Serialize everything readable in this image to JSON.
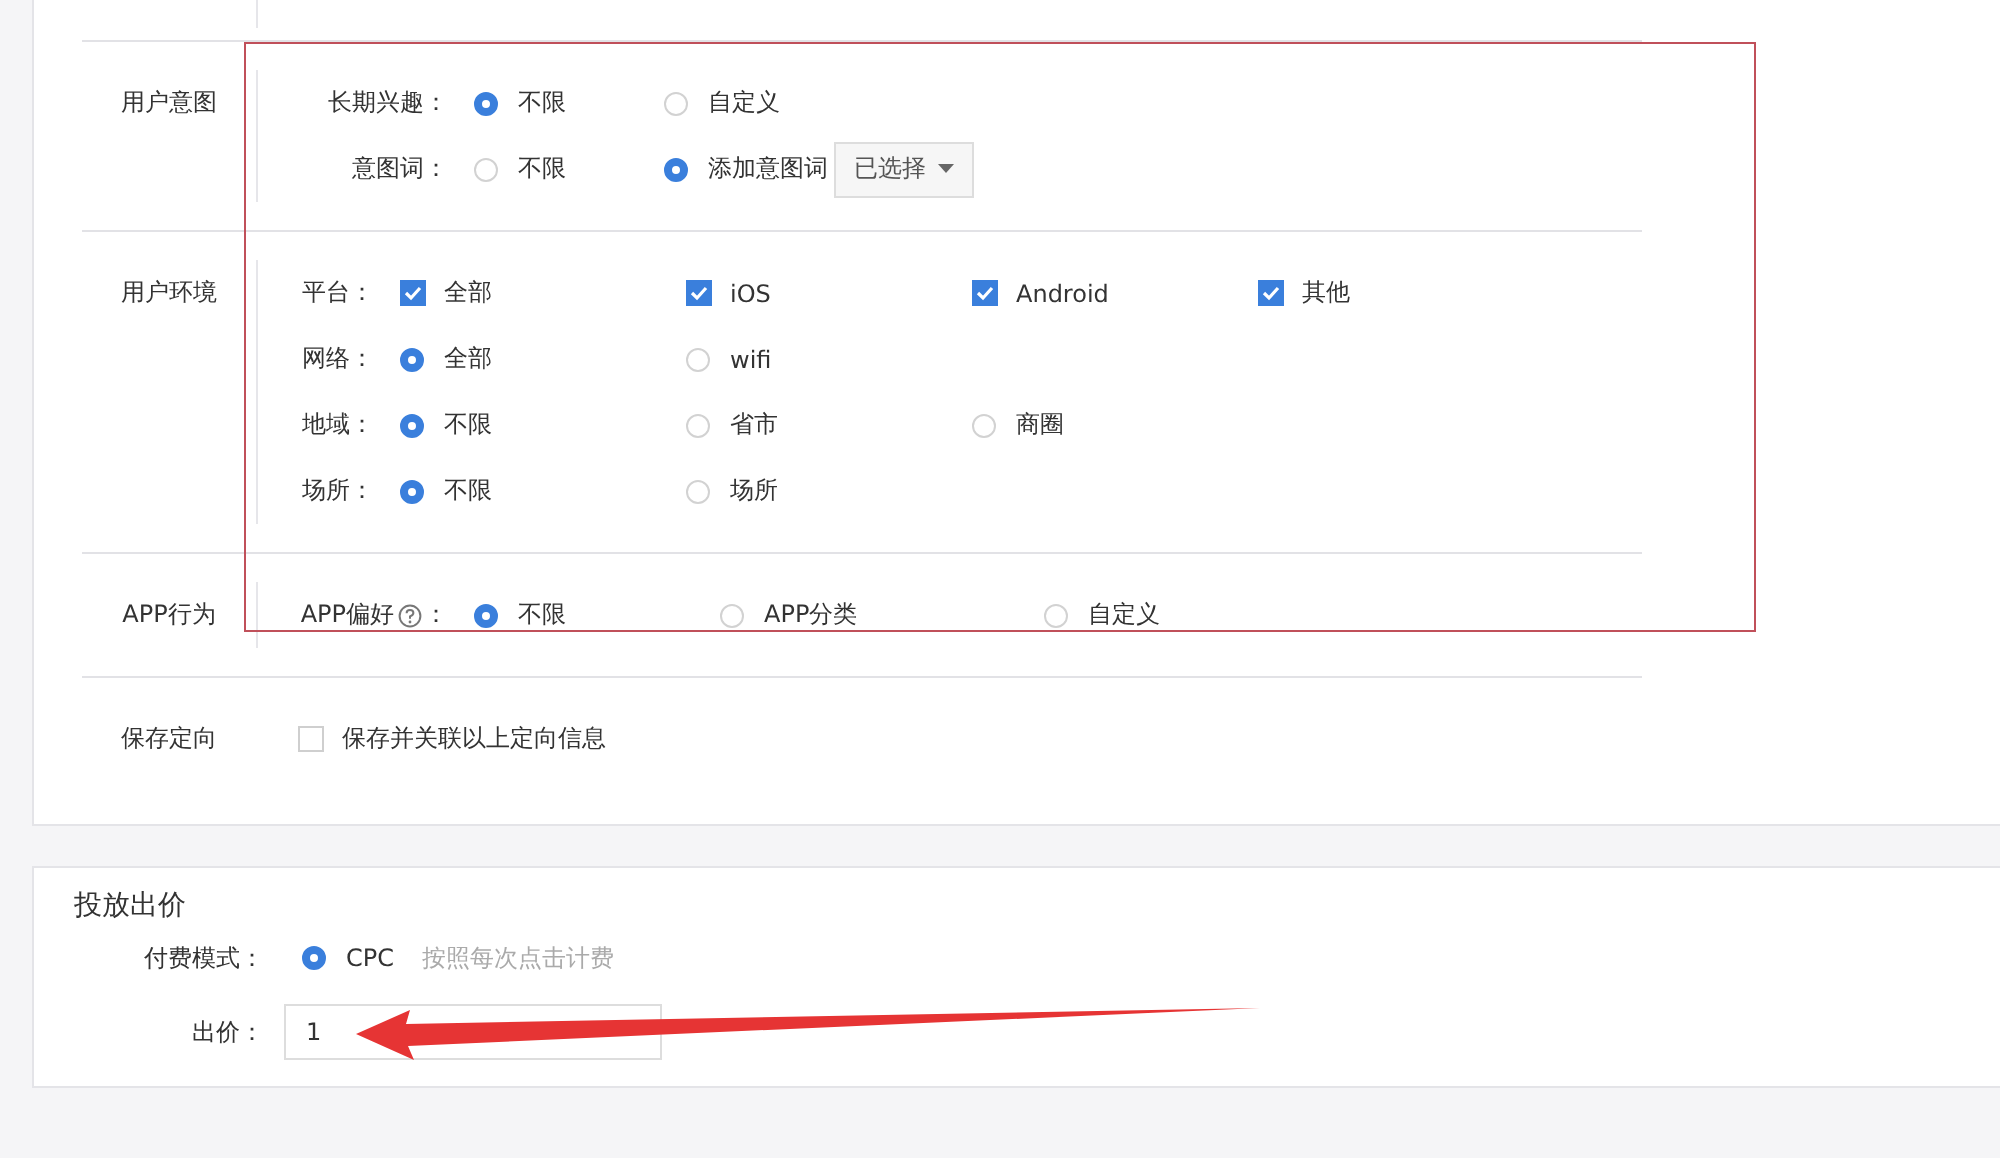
{
  "targeting": {
    "sections": [
      {
        "label": "用户意图",
        "rows": [
          {
            "label": "长期兴趣：",
            "kind": "radio",
            "options": [
              {
                "label": "不限",
                "selected": true
              },
              {
                "label": "自定义",
                "selected": false
              }
            ]
          },
          {
            "label": "意图词：",
            "kind": "radio",
            "options": [
              {
                "label": "不限",
                "selected": false
              },
              {
                "label": "添加意图词",
                "selected": true
              }
            ],
            "dropdown": {
              "label": "已选择"
            }
          }
        ]
      },
      {
        "label": "用户环境",
        "rows": [
          {
            "label": "平台：",
            "kind": "checkbox",
            "options": [
              {
                "label": "全部",
                "checked": true
              },
              {
                "label": "iOS",
                "checked": true
              },
              {
                "label": "Android",
                "checked": true
              },
              {
                "label": "其他",
                "checked": true
              }
            ]
          },
          {
            "label": "网络：",
            "kind": "radio",
            "options": [
              {
                "label": "全部",
                "selected": true
              },
              {
                "label": "wifi",
                "selected": false
              }
            ]
          },
          {
            "label": "地域：",
            "kind": "radio",
            "options": [
              {
                "label": "不限",
                "selected": true
              },
              {
                "label": "省市",
                "selected": false
              },
              {
                "label": "商圈",
                "selected": false
              }
            ]
          },
          {
            "label": "场所：",
            "kind": "radio",
            "options": [
              {
                "label": "不限",
                "selected": true
              },
              {
                "label": "场所",
                "selected": false
              }
            ]
          }
        ]
      },
      {
        "label": "APP行为",
        "rows": [
          {
            "label": "APP偏好",
            "help": true,
            "label_end": "：",
            "kind": "radio",
            "options": [
              {
                "label": "不限",
                "selected": true
              },
              {
                "label": "APP分类",
                "selected": false
              },
              {
                "label": "自定义",
                "selected": false
              }
            ]
          }
        ]
      }
    ],
    "save": {
      "label": "保存定向",
      "option": {
        "label": "保存并关联以上定向信息",
        "checked": false
      }
    }
  },
  "bid": {
    "title": "投放出价",
    "payment": {
      "label": "付费模式：",
      "options": [
        {
          "label": "CPC",
          "selected": true
        }
      ],
      "hint": "按照每次点击计费"
    },
    "price": {
      "label": "出价：",
      "value": "1"
    }
  }
}
